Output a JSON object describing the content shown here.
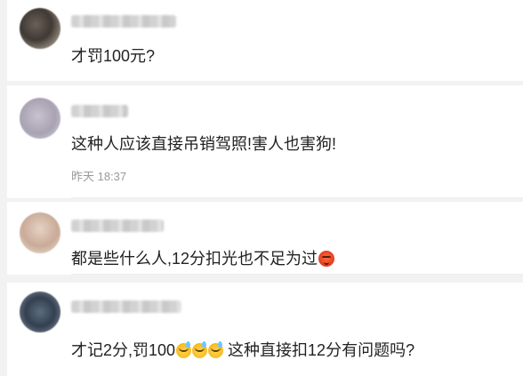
{
  "comments": [
    {
      "text": "才罚100元?"
    },
    {
      "text": "这种人应该直接吊销驾照!害人也害狗!",
      "time": "昨天 18:37"
    },
    {
      "text": "都是些什么人,12分扣光也不足为过",
      "emoji": "angry-face-icon"
    },
    {
      "text_before": "才记2分,罚100",
      "emoji": "sweat-smile-icon",
      "text_after": " 这种直接扣12分有问题吗?"
    }
  ]
}
